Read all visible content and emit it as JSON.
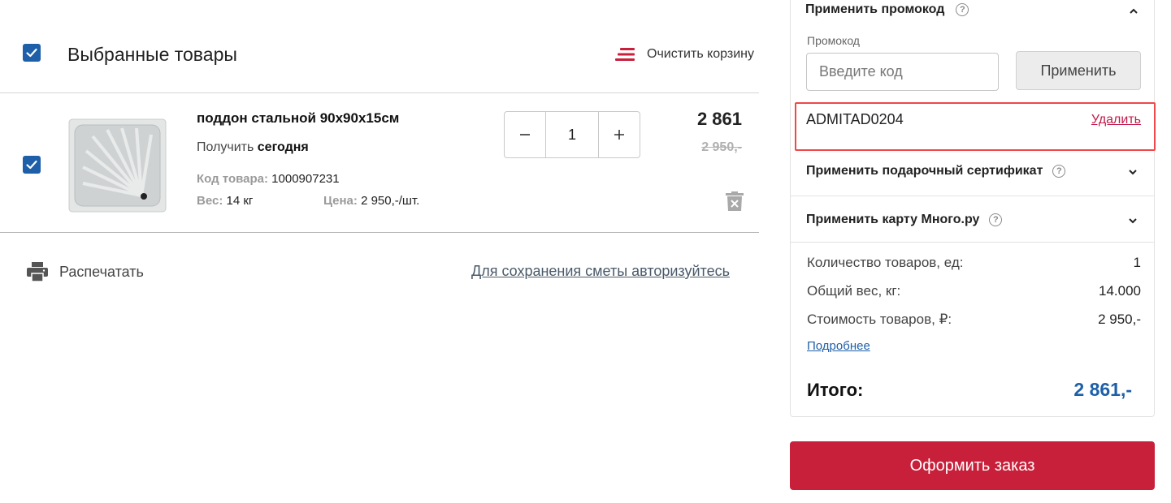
{
  "cart": {
    "title": "Выбранные товары",
    "clear_label": "Очистить корзину",
    "items": [
      {
        "name": "поддон стальной 90х90х15см",
        "pickup_prefix": "Получить",
        "pickup_when": "сегодня",
        "code_label": "Код товара:",
        "code": "1000907231",
        "weight_label": "Вес:",
        "weight": "14 кг",
        "unit_price_label": "Цена:",
        "unit_price": "2 950,-/шт.",
        "quantity": "1",
        "price_now": "2 861",
        "price_old": "2 950,-"
      }
    ],
    "print_label": "Распечатать",
    "auth_link": "Для сохранения сметы авторизуйтесь"
  },
  "summary": {
    "promo": {
      "title": "Применить промокод",
      "help": "?",
      "field_label": "Промокод",
      "placeholder": "Введите код",
      "apply_label": "Применить",
      "applied_code": "ADMITAD0204",
      "remove_label": "Удалить"
    },
    "gift": {
      "title": "Применить подарочный сертификат",
      "help": "?"
    },
    "card": {
      "title": "Применить карту Много.ру",
      "help": "?"
    },
    "stats": [
      {
        "label": "Количество товаров, ед:",
        "value": "1"
      },
      {
        "label": "Общий вес, кг:",
        "value": "14.000"
      },
      {
        "label": "Стоимость товаров, ₽:",
        "value": "2 950,-"
      }
    ],
    "more_link": "Подробнее",
    "total_label": "Итого:",
    "total_value": "2 861,-",
    "checkout_label": "Оформить заказ"
  },
  "colors": {
    "accent_blue": "#1d5fa8",
    "checkout_red": "#c8203a",
    "highlight_red": "#f04848",
    "remove_link": "#c21a4a"
  }
}
